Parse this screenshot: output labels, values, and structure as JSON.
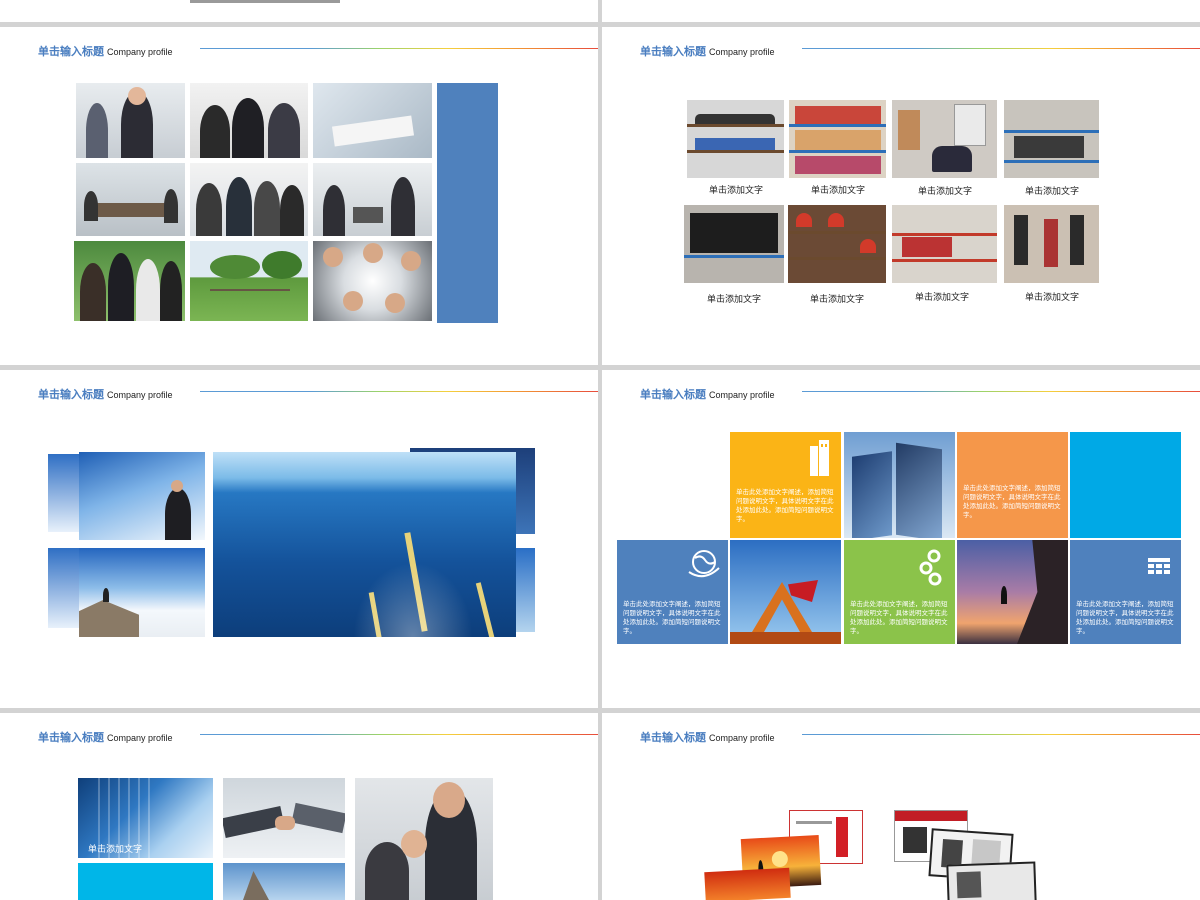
{
  "slide_header": {
    "title_cn": "单击输入标题",
    "title_en": "Company profile"
  },
  "warehouse": {
    "captions": [
      "单击添加文字",
      "单击添加文字",
      "单击添加文字",
      "单击添加文字",
      "单击添加文字",
      "单击添加文字",
      "单击添加文字",
      "单击添加文字"
    ]
  },
  "metro": {
    "yellow_text": "单击此处添加文字阐述，添加简短问题说明文字，具体说明文字在此处添加此处。添加简短问题说明文字。",
    "orange_text": "单击此处添加文字阐述，添加简短问题说明文字，具体说明文字在此处添加此处。添加简短问题说明文字。",
    "blue_left_text": "单击此处添加文字阐述，添加简短问题说明文字，具体说明文字在此处添加此处。添加简短问题说明文字。",
    "green_text": "单击此处添加文字阐述，添加简短问题说明文字，具体说明文字在此处添加此处。添加简短问题说明文字。",
    "blue_right_text": "单击此处添加文字阐述，添加简短问题说明文字，具体说明文字在此处添加此处。添加简短问题说明文字。",
    "colors": {
      "yellow": "#fbb416",
      "orange": "#f5974a",
      "cyan": "#00a9e6",
      "blue": "#4f81bd",
      "green": "#8bc34a"
    }
  },
  "bottom_left": {
    "photo_caption": "单击添加文字"
  }
}
